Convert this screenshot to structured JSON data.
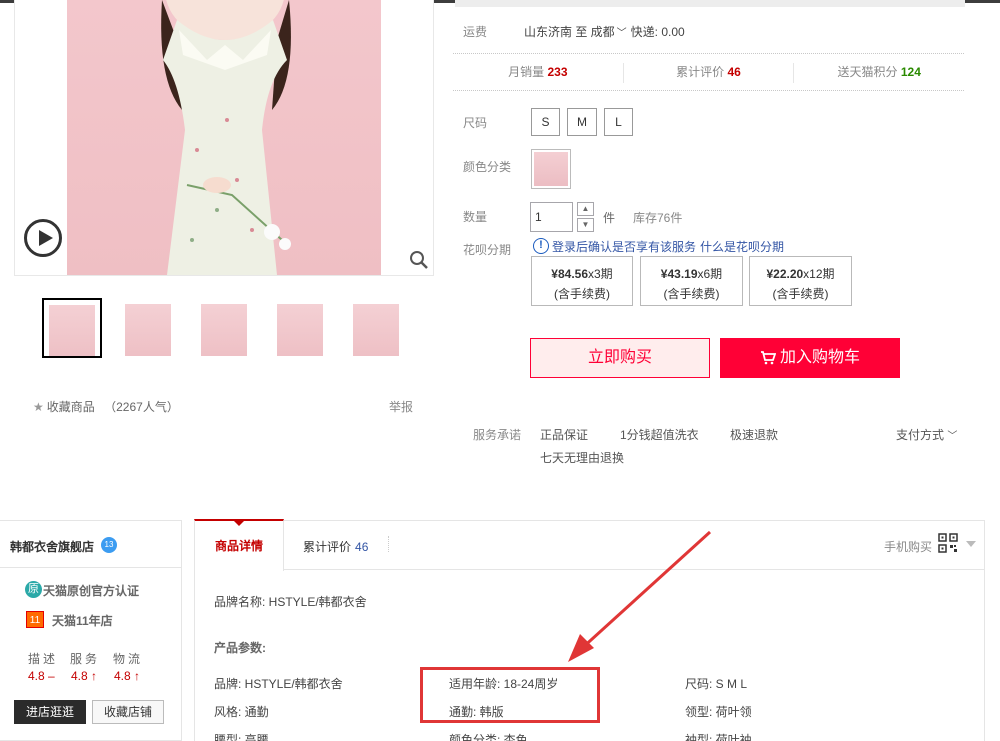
{
  "product": {
    "shipping_label": "运费",
    "shipping_route": "山东济南 至 成都",
    "shipping_fee": "快递: 0.00",
    "stats": [
      {
        "label": "月销量",
        "value": "233",
        "color": "red"
      },
      {
        "label": "累计评价",
        "value": "46",
        "color": "red"
      },
      {
        "label": "送天猫积分",
        "value": "124",
        "color": "green"
      }
    ],
    "size_label": "尺码",
    "sizes": [
      "S",
      "M",
      "L"
    ],
    "color_label": "颜色分类",
    "qty_label": "数量",
    "qty_value": "1",
    "qty_unit": "件",
    "stock": "库存76件",
    "huabei_label": "花呗分期",
    "huabei_notice": "登录后确认是否享有该服务",
    "huabei_link": "什么是花呗分期",
    "installments": [
      {
        "amount": "¥84.56",
        "period": "x3期",
        "fee": "(含手续费)"
      },
      {
        "amount": "¥43.19",
        "period": "x6期",
        "fee": "(含手续费)"
      },
      {
        "amount": "¥22.20",
        "period": "x12期",
        "fee": "(含手续费)"
      }
    ],
    "buy_now": "立即购买",
    "add_cart": "加入购物车",
    "service_label": "服务承诺",
    "services": [
      "正品保证",
      "1分钱超值洗衣",
      "极速退款",
      "七天无理由退换"
    ],
    "pay_way": "支付方式",
    "favorite": "收藏商品",
    "popularity": "（2267人气）",
    "report": "举报"
  },
  "shop": {
    "name": "韩都衣舍旗舰店",
    "badge": "13",
    "original_cert": "天猫原创官方认证",
    "original_icon": "原",
    "years_icon": "11",
    "years_text": "天猫11年店",
    "dsr_labels": [
      "描述",
      "服务",
      "物流"
    ],
    "dsr_values": [
      "4.8 –",
      "4.8 ↑",
      "4.8 ↑"
    ],
    "enter_btn": "进店逛逛",
    "collect_btn": "收藏店铺"
  },
  "tabs": {
    "detail": "商品详情",
    "review": "累计评价",
    "review_count": "46",
    "mobile_buy": "手机购买"
  },
  "details": {
    "brand_name": "品牌名称: HSTYLE/韩都衣舍",
    "params_title": "产品参数:",
    "attrs": [
      "品牌: HSTYLE/韩都衣舍",
      "适用年龄: 18-24周岁",
      "尺码: S M L",
      "风格: 通勤",
      "通勤: 韩版",
      "领型: 荷叶领",
      "腰型: 高腰",
      "颜色分类: 杏色",
      "袖型: 荷叶袖"
    ]
  },
  "colors": {
    "accent_red": "#ff0036",
    "tmall_red": "#c40000",
    "highlight": "#e03636"
  }
}
